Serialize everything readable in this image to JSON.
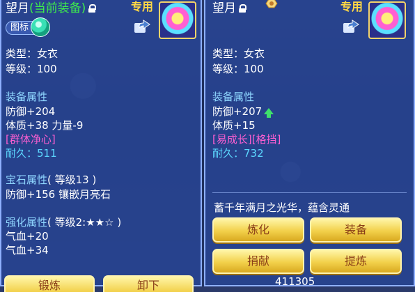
{
  "left": {
    "title_name": "望月",
    "title_current": "(当前装备)",
    "exclusive": "专用",
    "icon_label": "图标",
    "type": "类型：女衣",
    "level": "等级：100",
    "equip_attr_title": "装备属性",
    "defense": "防御+204",
    "constitution": "体质+38 力量-9",
    "special": "[群体净心]",
    "durability_label": "耐久：",
    "durability_value": "511",
    "gem_title": "宝石属性",
    "gem_level": "( 等级13 )",
    "gem_line": "防御+156 镶嵌月亮石",
    "strengthen_title": "强化属性",
    "strengthen_level": "( 等级2:★★☆ )",
    "strengthen_1": "气血+20",
    "strengthen_2": "气血+34",
    "btn_1": "锻炼",
    "btn_2": "卸下"
  },
  "right": {
    "title_name": "望月",
    "exclusive": "专用",
    "type": "类型：女衣",
    "level": "等级：100",
    "equip_attr_title": "装备属性",
    "defense": "防御+207",
    "constitution": "体质+15",
    "special": "[易成长][格挡]",
    "durability_label": "耐久：",
    "durability_value": "732",
    "description": "蓄千年满月之光华，蕴含灵通",
    "btn_refine": "炼化",
    "btn_equip": "装备",
    "btn_donate": "捐献",
    "btn_extract": "提炼",
    "bottom_number": "411305"
  },
  "colors": {
    "panel": "#2846a0",
    "button_gold": "#f2d04a",
    "button_text": "#8a3e18",
    "section_blue": "#8fd6ff",
    "special_pink": "#ff5fd2",
    "durability_cyan": "#5cd8ff",
    "current_green": "#3ff04a",
    "arrow_green": "#3fe06b"
  },
  "icons": [
    "lock-icon",
    "share-icon",
    "toggle-orb-icon",
    "badge-icon",
    "up-arrow-icon",
    "equipment-icon"
  ]
}
